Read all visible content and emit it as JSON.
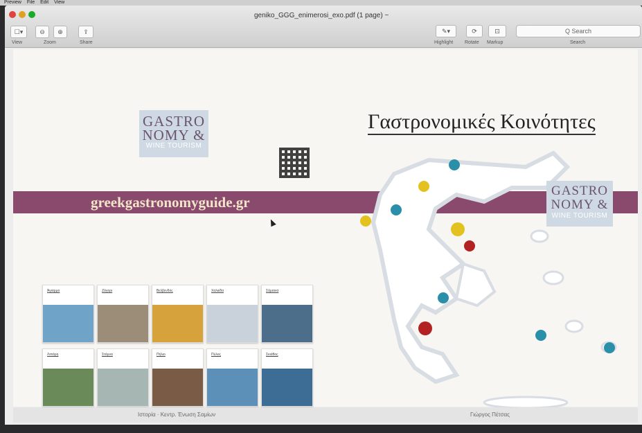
{
  "menubar": {
    "app": "Preview",
    "items": [
      "File",
      "Edit",
      "View"
    ]
  },
  "window": {
    "title": "geniko_GGG_enimerosi_exo.pdf (1 page) ~",
    "toolbar": {
      "view_label": "View",
      "zoom_label": "Zoom",
      "share_label": "Share",
      "highlight_label": "Highlight",
      "rotate_label": "Rotate",
      "markup_label": "Markup",
      "search_placeholder": "Q Search",
      "search_label": "Search"
    }
  },
  "document": {
    "logo": {
      "line1": "GASTRO",
      "line2": "NOMY &",
      "line3": "WINE TOURISM"
    },
    "url": "greekgastronomyguide.gr",
    "map_title": "Γαστρονομικές Κοινότητες",
    "cards": [
      {
        "label": "Άγιαρμο",
        "color": "#6fa3c8"
      },
      {
        "label": "Ζάγορι",
        "color": "#9b8d78"
      },
      {
        "label": "Βελβενδός",
        "color": "#d6a23b"
      },
      {
        "label": "Χαλκίδα",
        "color": "#c9d2db"
      },
      {
        "label": "Σάμαινα",
        "color": "#4d6e8a"
      },
      {
        "label": "Λιπάρη",
        "color": "#6b8a5a"
      },
      {
        "label": "Στάμνα",
        "color": "#a6b6b3"
      },
      {
        "label": "Πήλιο",
        "color": "#7a5b45"
      },
      {
        "label": "Πύλος",
        "color": "#5c90b8"
      },
      {
        "label": "Σκιάθος",
        "color": "#3d6c94"
      }
    ],
    "pins": [
      {
        "color": "#2a8fa8"
      },
      {
        "color": "#e3c21f"
      },
      {
        "color": "#2a8fa8"
      },
      {
        "color": "#e3c21f"
      },
      {
        "color": "#e3c21f"
      },
      {
        "color": "#b22222"
      },
      {
        "color": "#2a8fa8"
      },
      {
        "color": "#b22222"
      },
      {
        "color": "#2a8fa8"
      },
      {
        "color": "#2a8fa8"
      }
    ]
  },
  "statusbar": {
    "left": "Ιστορία · Κεντρ. Ένωση Σαμίων",
    "right": "Γιώργος Πέτσας"
  }
}
